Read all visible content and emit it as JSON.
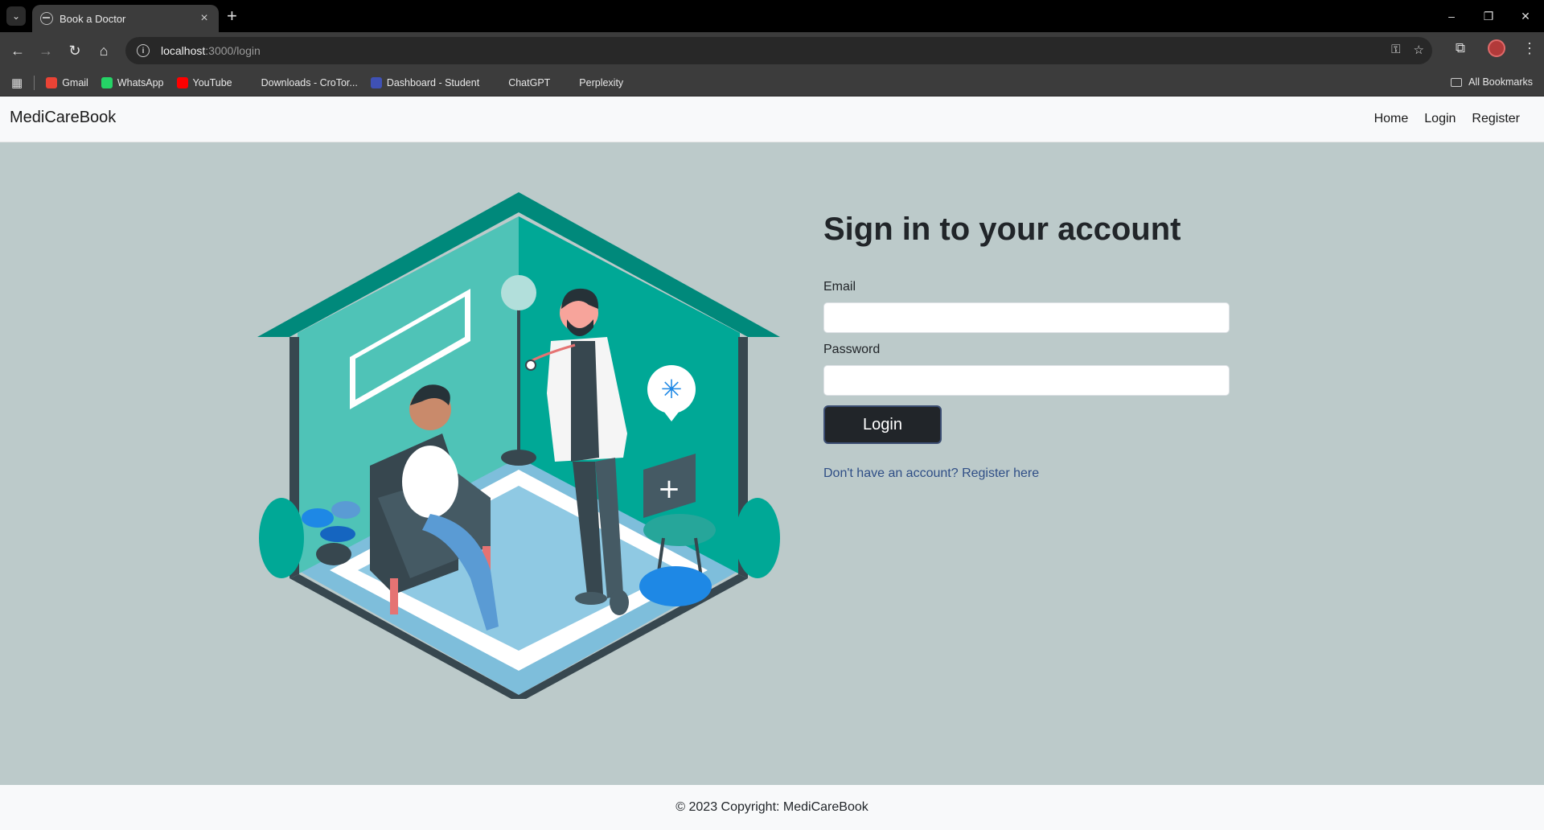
{
  "browser": {
    "tab_title": "Book a Doctor",
    "url_host": "localhost",
    "url_path": ":3000/login",
    "bookmarks": [
      {
        "label": "Gmail",
        "icon": "gmail-icon",
        "color": "#ea4335"
      },
      {
        "label": "WhatsApp",
        "icon": "whatsapp-icon",
        "color": "#25d366"
      },
      {
        "label": "YouTube",
        "icon": "youtube-icon",
        "color": "#ff0000"
      },
      {
        "label": "Downloads - CroTor...",
        "icon": "download-icon",
        "color": "#3c3c3c"
      },
      {
        "label": "Dashboard - Student",
        "icon": "dashboard-icon",
        "color": "#3f51b5"
      },
      {
        "label": "ChatGPT",
        "icon": "chatgpt-icon",
        "color": "#3c3c3c"
      },
      {
        "label": "Perplexity",
        "icon": "perplexity-icon",
        "color": "#3c3c3c"
      }
    ],
    "all_bookmarks": "All Bookmarks"
  },
  "navbar": {
    "brand": "MediCareBook",
    "links": [
      "Home",
      "Login",
      "Register"
    ]
  },
  "form": {
    "heading": "Sign in to your account",
    "email_label": "Email",
    "email_value": "",
    "password_label": "Password",
    "password_value": "",
    "submit_label": "Login",
    "register_link": "Don't have an account? Register here"
  },
  "footer": {
    "copyright": "© 2023 Copyright: MediCareBook"
  },
  "colors": {
    "page_bg": "#bccaca",
    "teal_dark": "#00897b",
    "teal": "#26a69a",
    "button_bg": "#212529",
    "link": "#2f4e86"
  }
}
